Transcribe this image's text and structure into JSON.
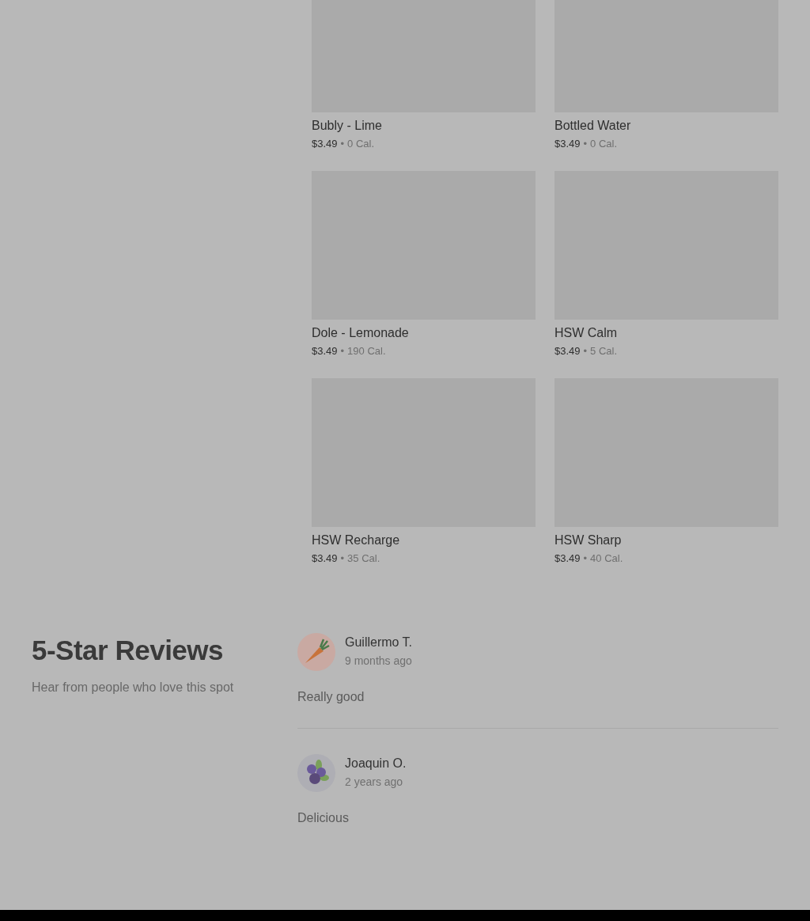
{
  "menu_items": [
    {
      "name": "Bubly - Lime",
      "price": "$3.49",
      "separator": "•",
      "calories": "0 Cal."
    },
    {
      "name": "Bottled Water",
      "price": "$3.49",
      "separator": "•",
      "calories": "0 Cal."
    },
    {
      "name": "Dole - Lemonade",
      "price": "$3.49",
      "separator": "•",
      "calories": "190 Cal."
    },
    {
      "name": "HSW Calm",
      "price": "$3.49",
      "separator": "•",
      "calories": "5 Cal."
    },
    {
      "name": "HSW Recharge",
      "price": "$3.49",
      "separator": "•",
      "calories": "35 Cal."
    },
    {
      "name": "HSW Sharp",
      "price": "$3.49",
      "separator": "•",
      "calories": "40 Cal."
    }
  ],
  "reviews_section": {
    "title": "5-Star Reviews",
    "subtitle": "Hear from people who love this spot"
  },
  "reviews": [
    {
      "author": "Guillermo T.",
      "time": "9 months ago",
      "text": "Really good",
      "kind": "carrot"
    },
    {
      "author": "Joaquin O.",
      "time": "2 years ago",
      "text": "Delicious",
      "kind": "berries"
    }
  ]
}
